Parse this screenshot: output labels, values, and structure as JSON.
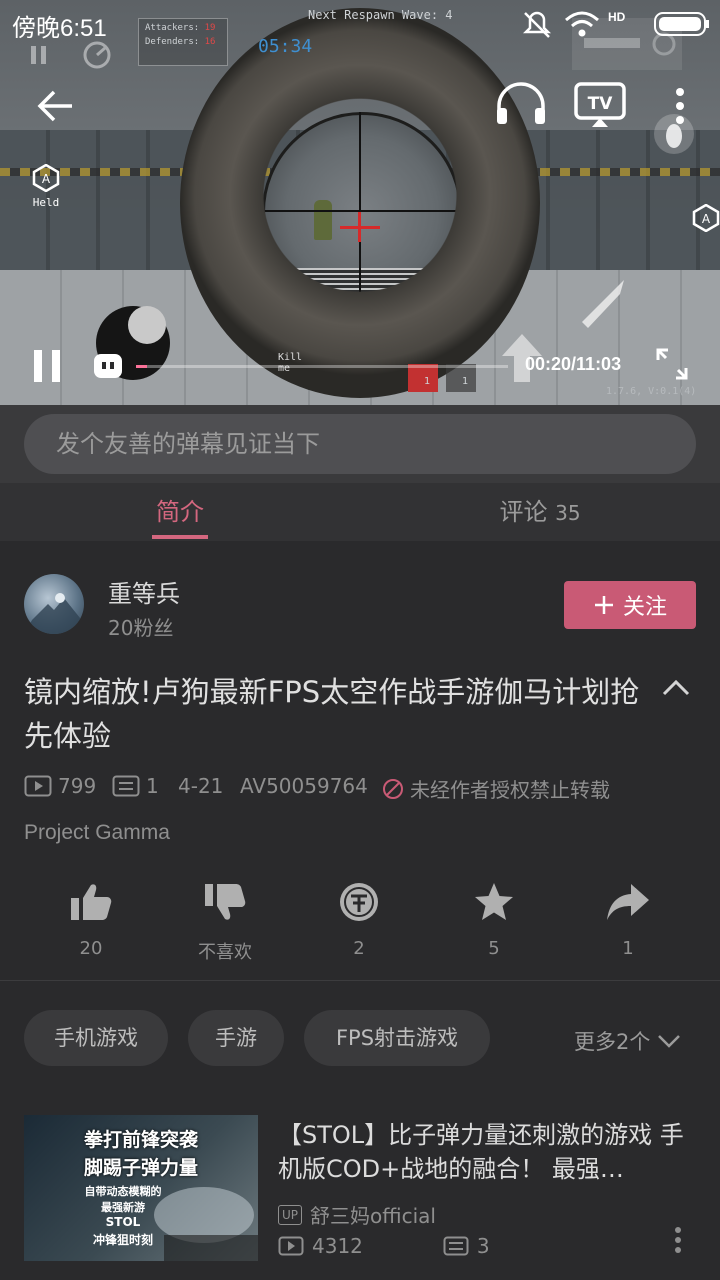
{
  "status_bar": {
    "time": "傍晚6:51",
    "network": "HD"
  },
  "video": {
    "hud": {
      "respawn": "Next Respawn Wave: 4",
      "attackers_label": "Attackers:",
      "attackers_value": "19",
      "defenders_label": "Defenders:",
      "defenders_value": "16",
      "timer": "05:34",
      "held_label": "Held",
      "a_badge": "A",
      "kill_label": "Kill\nme",
      "ammo_a": "1",
      "ammo_b": "1",
      "version": "1.7.6, V:0.1(4)"
    },
    "current_time": "00:20/11:03",
    "progress_fraction": 0.03,
    "colors": {
      "accent": "#fb7299"
    }
  },
  "danmaku": {
    "placeholder": "发个友善的弹幕见证当下"
  },
  "tabs": [
    {
      "label": "简介",
      "active": true
    },
    {
      "label": "评论",
      "count": "35",
      "active": false
    }
  ],
  "uploader": {
    "name": "重等兵",
    "fans": "20粉丝",
    "follow_label": "关注"
  },
  "video_info": {
    "title": "镜内缩放!卢狗最新FPS太空作战手游伽马计划抢先体验",
    "views": "799",
    "danmaku_count": "1",
    "date": "4-21",
    "av_id": "AV50059764",
    "copyright_notice": "未经作者授权禁止转载",
    "project": "Project Gamma"
  },
  "actions": [
    {
      "icon": "thumbs-up-icon",
      "label": "20"
    },
    {
      "icon": "thumbs-down-icon",
      "label": "不喜欢"
    },
    {
      "icon": "coin-icon",
      "label": "2"
    },
    {
      "icon": "star-icon",
      "label": "5"
    },
    {
      "icon": "share-icon",
      "label": "1"
    }
  ],
  "tags": [
    "手机游戏",
    "手游",
    "FPS射击游戏"
  ],
  "more_tags": "更多2个",
  "recommended": {
    "title": "【STOL】比子弹力量还刺激的游戏 手机版COD+战地的融合！ 最强…",
    "up_badge": "UP",
    "uploader": "舒三妈official",
    "views": "4312",
    "danmaku": "3",
    "thumb_lines": [
      "拳打前锋突袭",
      "脚踢子弹力量",
      "自带动态模糊的",
      "最强新游",
      "STOL",
      "冲锋狙时刻"
    ]
  }
}
